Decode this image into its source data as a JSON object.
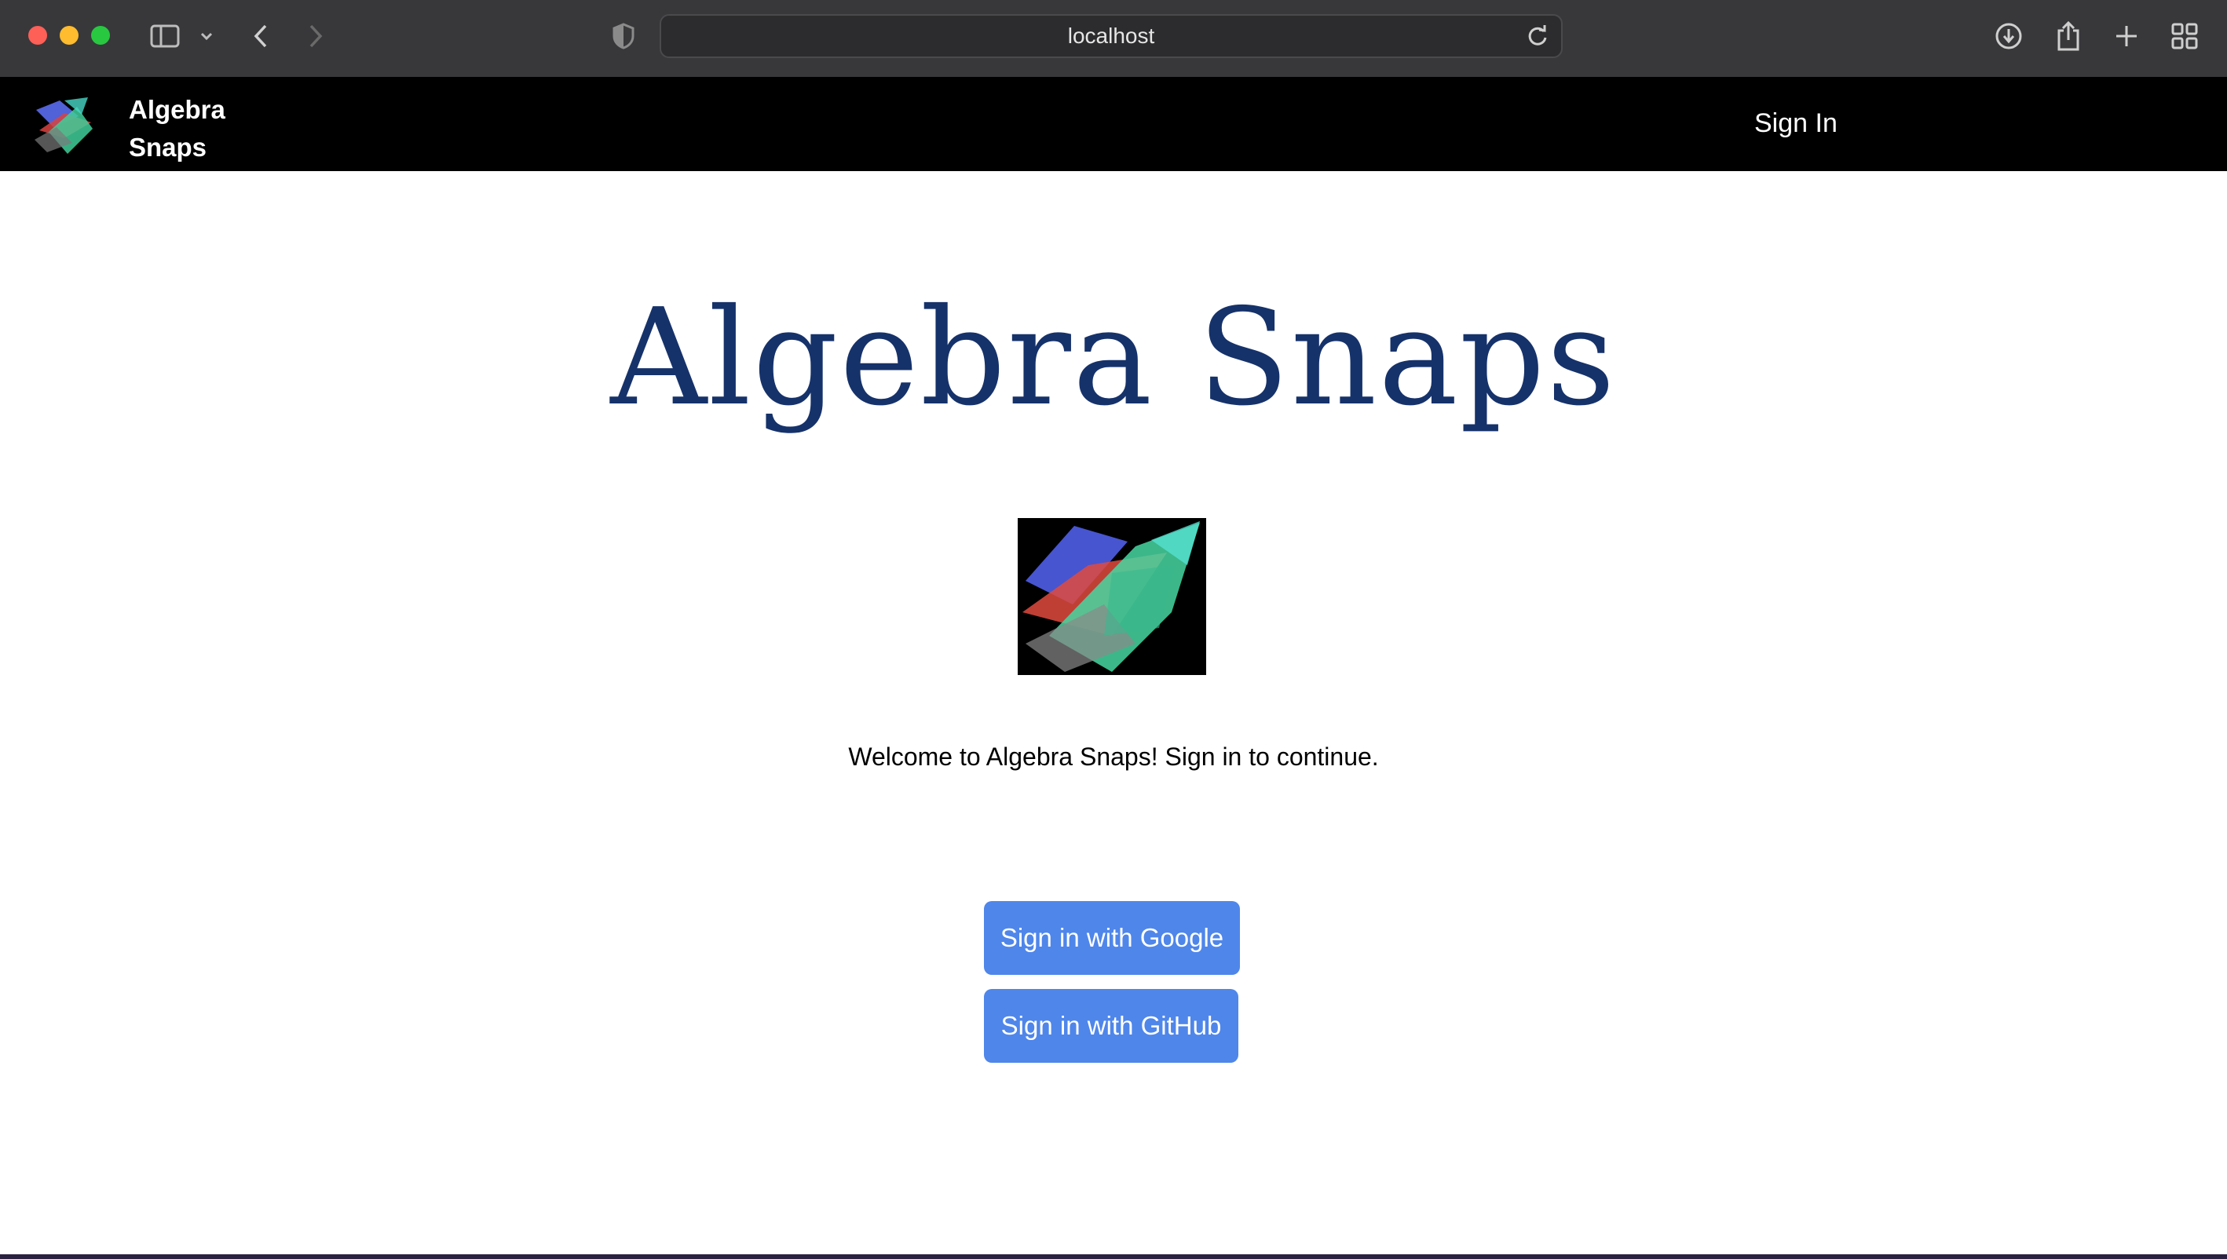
{
  "browser": {
    "url": "localhost",
    "icons": {
      "sidebar": "sidebar-icon",
      "chevron": "chevron-down-icon",
      "back": "back-arrow-icon",
      "forward": "forward-arrow-icon",
      "privacy": "shield-icon",
      "reload": "reload-icon",
      "downloads": "download-icon",
      "share": "share-icon",
      "new_tab": "plus-icon",
      "tab_overview": "grid-icon"
    }
  },
  "navbar": {
    "brand_line1": "Algebra",
    "brand_line2": "Snaps",
    "sign_in": "Sign In"
  },
  "main": {
    "title": "Algebra Snaps",
    "welcome": "Welcome to Algebra Snaps! Sign in to continue.",
    "buttons": {
      "google": "Sign in with Google",
      "github": "Sign in with GitHub"
    }
  },
  "colors": {
    "navbar_bg": "#000000",
    "title": "#16326a",
    "button": "#4f86ea"
  }
}
